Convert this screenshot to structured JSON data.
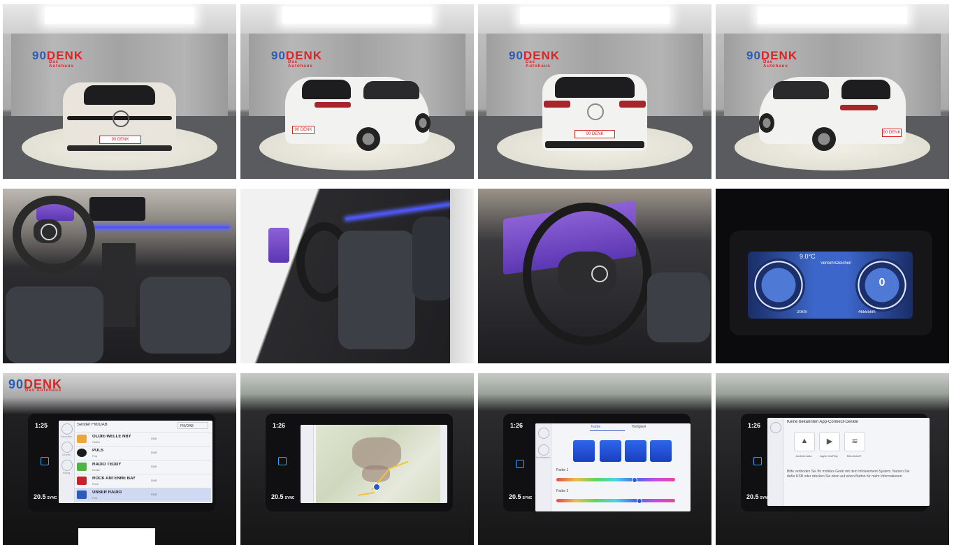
{
  "gallery": {
    "rows": 3,
    "cols": 4,
    "showroom_logo": {
      "num": "90",
      "brand": "DENK",
      "sub": "Das Autohaus"
    },
    "photos": [
      {
        "name": "exterior-front",
        "plate": "90 DENK"
      },
      {
        "name": "exterior-rear-left",
        "plate": "90 DENK"
      },
      {
        "name": "exterior-rear",
        "plate": "90 DENK"
      },
      {
        "name": "exterior-rear-right",
        "plate": "90 DENK"
      },
      {
        "name": "interior-dashboard"
      },
      {
        "name": "interior-driver-seat"
      },
      {
        "name": "interior-steering-wheel"
      },
      {
        "name": "digital-cockpit",
        "cluster_top": "9.0°C",
        "cluster_center": "Verkehrszeichen",
        "speed": "0",
        "range": "20km",
        "odo": "46555km"
      },
      {
        "name": "infotainment-radio",
        "time": "1:25",
        "temp": "20.5",
        "sync": "SYNC"
      },
      {
        "name": "infotainment-map",
        "time": "1:26",
        "temp": "20.5",
        "sync": "SYNC"
      },
      {
        "name": "infotainment-ambient",
        "time": "1:26",
        "temp": "20.5",
        "sync": "SYNC"
      },
      {
        "name": "infotainment-app-connect",
        "time": "1:26",
        "temp": "20.5",
        "sync": "SYNC"
      }
    ]
  },
  "radio": {
    "header": "Sender FM/DAB",
    "select": "FM/DAB",
    "stations": [
      {
        "name": "OLDIE-WELLE NBY",
        "genre": "Oldies",
        "tag": "DAB",
        "color": "#e8a93a"
      },
      {
        "name": "PULS",
        "genre": "Pop",
        "tag": "DAB",
        "color": "#1b1b1b"
      },
      {
        "name": "RADIO TEDDY",
        "genre": "Kinder",
        "tag": "DAB",
        "color": "#4fb542"
      },
      {
        "name": "ROCK ANTENNE BAY",
        "genre": "Rock",
        "tag": "DAB",
        "color": "#c8232c"
      },
      {
        "name": "UNSER RADIO",
        "genre": "Pop",
        "tag": "DAB",
        "color": "#2b5db8"
      }
    ]
  },
  "ambient": {
    "tab_color": "Farbe",
    "tab_brightness": "Helligkeit",
    "slider1": "Farbe 1",
    "slider2": "Farbe 2",
    "slider1_value": 0.66,
    "slider2_value": 0.7
  },
  "appconnect": {
    "title": "Keine bekannten App-Connect-Geräte",
    "apps": [
      {
        "glyph": "▲",
        "label": "Android Auto"
      },
      {
        "glyph": "▶",
        "label": "Apple CarPlay"
      },
      {
        "glyph": "≋",
        "label": "MirrorLink®"
      }
    ],
    "hint": "Bitte verbinden Sie Ihr mobiles Gerät mit dem Infotainment-System. Nutzen Sie dafür USB oder drücken Sie oben auf einen Button für mehr Informationen."
  },
  "menu": {
    "fav": "Favoriten",
    "src": "Quelle",
    "sound": "Klang",
    "light": "Lichtfarben"
  },
  "colors": {
    "accent": "#2d56d6",
    "brand_red": "#d82525",
    "brand_blue": "#2a5bb8"
  }
}
